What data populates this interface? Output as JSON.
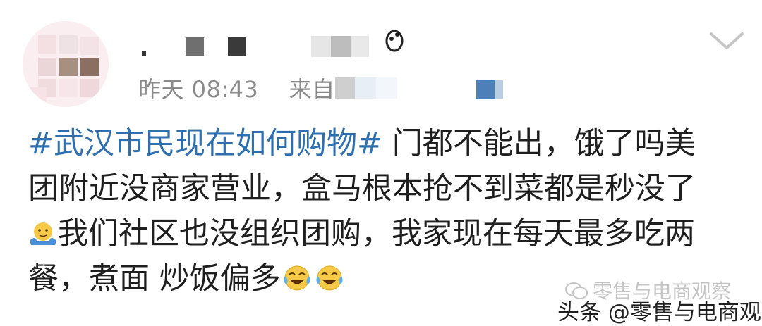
{
  "post": {
    "time": "昨天 08:43",
    "source_prefix": "来自",
    "avatar_icon": "pixelated-avatar",
    "expand_icon": "chevron-down-icon",
    "content": {
      "hashtag": "#武汉市民现在如何购物#",
      "line1_rest": "门都不能出，饿了吗美",
      "line2": "团附近没商家营业，盒马根本抢不到菜都是秒没了",
      "line3": "我们社区也没组织团购，我家现在每天最多吃两",
      "line4": "餐，煮面 炒饭偏多",
      "emoji_shrug": "shrug-emoji",
      "emoji_crying": "crying-laughing-emoji"
    }
  },
  "watermark": {
    "wechat": "零售与电商观察",
    "toutiao": "头条 @零售与电商观察"
  },
  "colors": {
    "hashtag": "#2e6fb0",
    "meta": "#8a8a8a",
    "text": "#1f1f1f"
  }
}
